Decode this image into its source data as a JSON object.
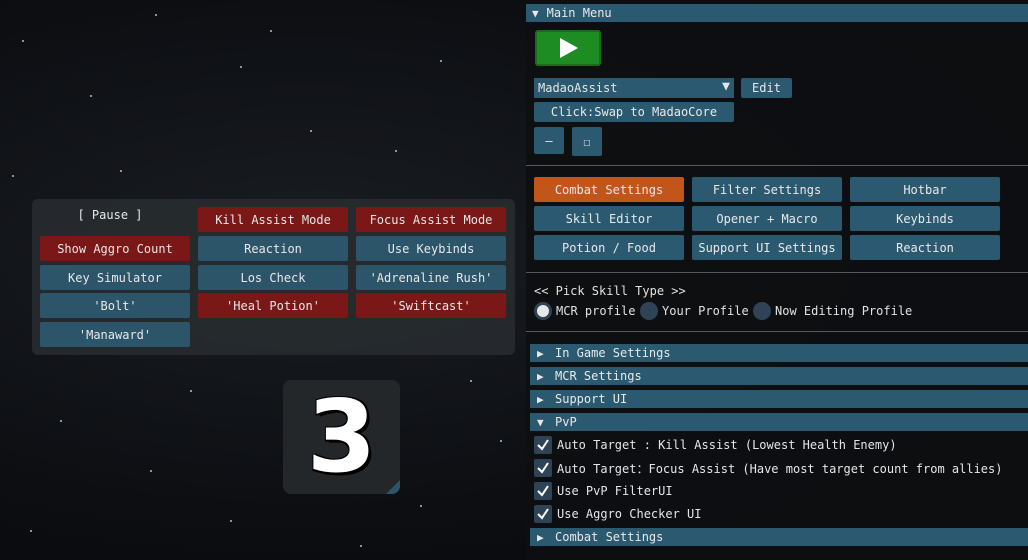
{
  "hotbar": {
    "pause": "[ Pause ]",
    "kill_assist": "Kill Assist Mode",
    "focus_assist": "Focus Assist Mode",
    "show_aggro": "Show Aggro Count",
    "reaction": "Reaction",
    "use_keybinds": "Use Keybinds",
    "key_simulator": "Key Simulator",
    "los_check": "Los Check",
    "adrenaline": "'Adrenaline Rush'",
    "bolt": "'Bolt'",
    "heal_potion": "'Heal Potion'",
    "swiftcast": "'Swiftcast'",
    "manaward": "'Manaward'"
  },
  "counter": {
    "value": "3"
  },
  "colors": {
    "accent_blue": "#2b5a70",
    "accent_red": "#7a1717",
    "active_orange": "#c2561a",
    "play_green": "#1c8c23"
  },
  "main_menu": {
    "title": "Main Menu",
    "profile_select": "MadaoAssist",
    "edit_label": "Edit",
    "swap_label": "Click:Swap to MadaoCore",
    "minimize_label": "—",
    "maximize_label": "☐",
    "tabs": [
      {
        "label": "Combat Settings"
      },
      {
        "label": "Filter Settings"
      },
      {
        "label": "Hotbar"
      },
      {
        "label": "Skill Editor"
      },
      {
        "label": "Opener + Macro"
      },
      {
        "label": "Keybinds"
      },
      {
        "label": "Potion / Food"
      },
      {
        "label": "Support UI Settings"
      },
      {
        "label": "Reaction"
      }
    ],
    "pick_skill_type": "<< Pick Skill Type >>",
    "radios": [
      {
        "label": "MCR profile",
        "selected": true
      },
      {
        "label": "Your Profile",
        "selected": false
      },
      {
        "label": "Now Editing Profile",
        "selected": false
      }
    ],
    "sections": {
      "in_game": "In Game Settings",
      "mcr": "MCR Settings",
      "support_ui": "Support UI",
      "pvp": "PvP",
      "combat": "Combat Settings"
    },
    "pvp_checks": [
      {
        "label": "Auto Target : Kill Assist (Lowest Health Enemy)",
        "checked": true
      },
      {
        "label": "Auto Target：Focus Assist (Have most target count from allies)",
        "checked": true
      },
      {
        "label": "Use PvP FilterUI",
        "checked": true
      },
      {
        "label": "Use Aggro Checker UI",
        "checked": true
      }
    ]
  }
}
